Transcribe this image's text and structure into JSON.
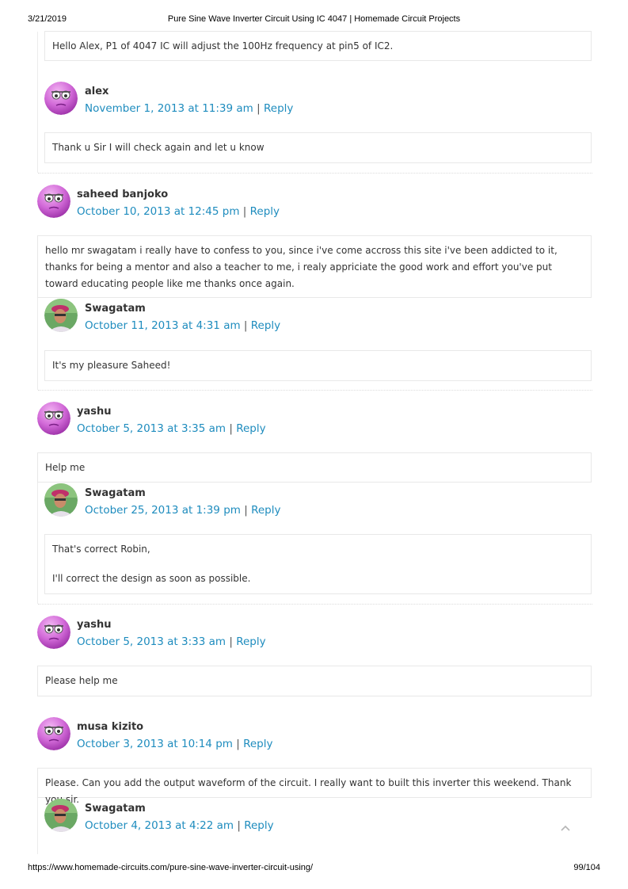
{
  "print_header": {
    "date": "3/21/2019",
    "title": "Pure Sine Wave Inverter Circuit Using IC 4047 | Homemade Circuit Projects"
  },
  "print_footer": {
    "url": "https://www.homemade-circuits.com/pure-sine-wave-inverter-circuit-using/",
    "page": "99/104"
  },
  "reply_label": "Reply",
  "separator": "|",
  "comments": [
    {
      "text": "Hello Alex, P1 of 4047 IC will adjust the 100Hz frequency at pin5 of IC2."
    },
    {
      "author": "alex",
      "date": "November 1, 2013 at 11:39 am",
      "paragraphs": [
        "Thank u Sir I will check again and let u know"
      ]
    },
    {
      "author": "saheed banjoko",
      "date": "October 10, 2013 at 12:45 pm",
      "paragraphs": [
        "hello mr swagatam i really have to confess to you, since i've come accross this site i've been addicted to it, thanks for being a mentor and also a teacher to me, i realy appriciate the good work and effort you've put toward educating people like me thanks once again."
      ]
    },
    {
      "author": "Swagatam",
      "date": "October 11, 2013 at 4:31 am",
      "paragraphs": [
        "It's my pleasure Saheed!"
      ]
    },
    {
      "author": "yashu",
      "date": "October 5, 2013 at 3:35 am",
      "paragraphs": [
        "Help me"
      ]
    },
    {
      "author": "Swagatam",
      "date": "October 25, 2013 at 1:39 pm",
      "paragraphs": [
        "That's correct Robin,",
        "I'll correct the design as soon as possible."
      ]
    },
    {
      "author": "yashu",
      "date": "October 5, 2013 at 3:33 am",
      "paragraphs": [
        "Please help me"
      ]
    },
    {
      "author": "musa kizito",
      "date": "October 3, 2013 at 10:14 pm",
      "paragraphs": [
        "Please. Can you add the output waveform of the circuit. I really want to built this inverter this weekend. Thank you sir."
      ]
    },
    {
      "author": "Swagatam",
      "date": "October 4, 2013 at 4:22 am"
    }
  ],
  "colors": {
    "link": "#1e8cbe",
    "text": "#333333",
    "border": "#e8e8e8"
  }
}
